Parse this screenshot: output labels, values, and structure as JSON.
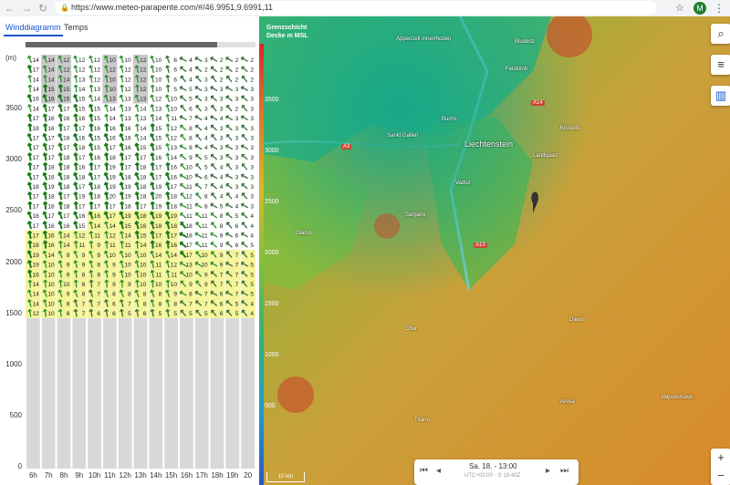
{
  "browser": {
    "url": "https://www.meteo-parapente.com/#/46.9951,9.6991,11",
    "back_icon": "back-arrow-icon",
    "forward_icon": "forward-arrow-icon",
    "reload_icon": "reload-icon",
    "avatar_letter": "M"
  },
  "tabs": [
    {
      "label": "Winddiagramm",
      "active": true
    },
    {
      "label": "Temps",
      "active": false
    }
  ],
  "diagram": {
    "unit_label": "(m)",
    "y_ticks": [
      "3500",
      "3000",
      "2500",
      "2000",
      "1500",
      "1000",
      "500",
      "0"
    ],
    "hours": [
      "6h",
      "7h",
      "8h",
      "9h",
      "10h",
      "11h",
      "12h",
      "13h",
      "14h",
      "15h",
      "16h",
      "17h",
      "18h",
      "19h",
      "20"
    ],
    "level_count": 27,
    "speeds": [
      [
        14,
        14,
        12,
        12,
        12,
        10,
        10,
        12,
        10,
        6,
        4,
        3,
        2,
        2,
        2
      ],
      [
        17,
        14,
        12,
        12,
        12,
        12,
        12,
        12,
        10,
        6,
        4,
        2,
        2,
        2,
        2
      ],
      [
        14,
        14,
        14,
        13,
        12,
        10,
        12,
        12,
        10,
        6,
        4,
        3,
        2,
        2,
        2
      ],
      [
        14,
        15,
        15,
        14,
        13,
        10,
        12,
        12,
        10,
        5,
        5,
        3,
        3,
        3,
        3
      ],
      [
        16,
        16,
        15,
        15,
        14,
        13,
        13,
        13,
        12,
        10,
        5,
        3,
        3,
        3,
        3
      ],
      [
        14,
        17,
        17,
        15,
        15,
        14,
        13,
        14,
        13,
        10,
        6,
        3,
        3,
        2,
        3
      ],
      [
        17,
        16,
        16,
        16,
        15,
        14,
        13,
        13,
        14,
        11,
        7,
        4,
        4,
        3,
        3
      ],
      [
        18,
        16,
        17,
        17,
        16,
        16,
        16,
        14,
        15,
        12,
        8,
        4,
        3,
        3,
        3
      ],
      [
        17,
        17,
        18,
        16,
        15,
        16,
        16,
        14,
        15,
        12,
        8,
        4,
        3,
        3,
        3
      ],
      [
        17,
        17,
        17,
        18,
        15,
        17,
        16,
        15,
        15,
        13,
        8,
        4,
        3,
        3,
        3
      ],
      [
        17,
        17,
        18,
        17,
        16,
        18,
        17,
        17,
        16,
        14,
        9,
        5,
        3,
        3,
        3
      ],
      [
        17,
        18,
        18,
        16,
        17,
        19,
        17,
        18,
        17,
        16,
        10,
        5,
        4,
        3,
        3
      ],
      [
        17,
        18,
        18,
        18,
        17,
        19,
        18,
        18,
        17,
        16,
        10,
        6,
        4,
        3,
        3
      ],
      [
        18,
        19,
        18,
        17,
        18,
        19,
        19,
        18,
        19,
        17,
        11,
        7,
        4,
        3,
        3
      ],
      [
        17,
        18,
        17,
        19,
        18,
        20,
        19,
        18,
        20,
        18,
        12,
        8,
        4,
        4,
        3
      ],
      [
        17,
        18,
        18,
        17,
        17,
        17,
        18,
        17,
        19,
        18,
        11,
        8,
        5,
        4,
        3
      ],
      [
        16,
        17,
        17,
        16,
        16,
        17,
        19,
        18,
        19,
        19,
        11,
        11,
        8,
        5,
        4
      ],
      [
        17,
        16,
        16,
        15,
        14,
        14,
        15,
        16,
        18,
        18,
        18,
        11,
        8,
        6,
        4
      ],
      [
        17,
        16,
        14,
        12,
        11,
        12,
        14,
        15,
        17,
        17,
        18,
        11,
        9,
        6,
        4
      ],
      [
        18,
        16,
        14,
        11,
        9,
        11,
        11,
        14,
        16,
        16,
        17,
        11,
        9,
        6,
        5
      ],
      [
        19,
        14,
        9,
        9,
        9,
        10,
        10,
        10,
        14,
        14,
        17,
        10,
        9,
        7,
        5
      ],
      [
        19,
        10,
        9,
        9,
        8,
        9,
        10,
        10,
        11,
        12,
        13,
        10,
        9,
        7,
        5
      ],
      [
        16,
        10,
        9,
        8,
        8,
        9,
        10,
        10,
        11,
        11,
        10,
        9,
        7,
        7,
        5
      ],
      [
        14,
        10,
        10,
        8,
        7,
        9,
        9,
        10,
        10,
        10,
        9,
        9,
        7,
        7,
        5
      ],
      [
        14,
        10,
        9,
        8,
        7,
        8,
        8,
        8,
        8,
        9,
        8,
        7,
        6,
        7,
        5
      ],
      [
        14,
        10,
        9,
        7,
        7,
        6,
        7,
        8,
        8,
        8,
        7,
        7,
        6,
        5,
        4
      ],
      [
        12,
        10,
        8,
        7,
        6,
        6,
        5,
        6,
        5,
        5,
        5,
        5,
        6,
        5,
        4
      ]
    ]
  },
  "map": {
    "layer_label": "Grenzschicht Decke m MSL",
    "colorbar_ticks": [
      "3500",
      "3000",
      "2500",
      "2000",
      "1500",
      "1000",
      "500"
    ],
    "places": [
      "Appenzell Innerrhoden",
      "Liechtenstein",
      "Sankt Gallen",
      "Buchs",
      "Vaduz",
      "Glarus",
      "Chur",
      "Davos",
      "Landquart",
      "Sargans",
      "Feldkirch",
      "Klosters",
      "Arosa",
      "Bludenz",
      "Tirano",
      "Valposchiavo"
    ],
    "roads": [
      "A14",
      "A3",
      "A13"
    ],
    "time_main": "Sa. 18. - 13:00",
    "time_sub": "UTC+02:00 · ⏱ 18:40Z",
    "scale_label": "10 km",
    "buttons": [
      {
        "icon": "search-icon"
      },
      {
        "icon": "settings-sliders-icon"
      },
      {
        "icon": "bar-chart-icon"
      }
    ],
    "zoom_in": "+",
    "zoom_out": "−"
  }
}
